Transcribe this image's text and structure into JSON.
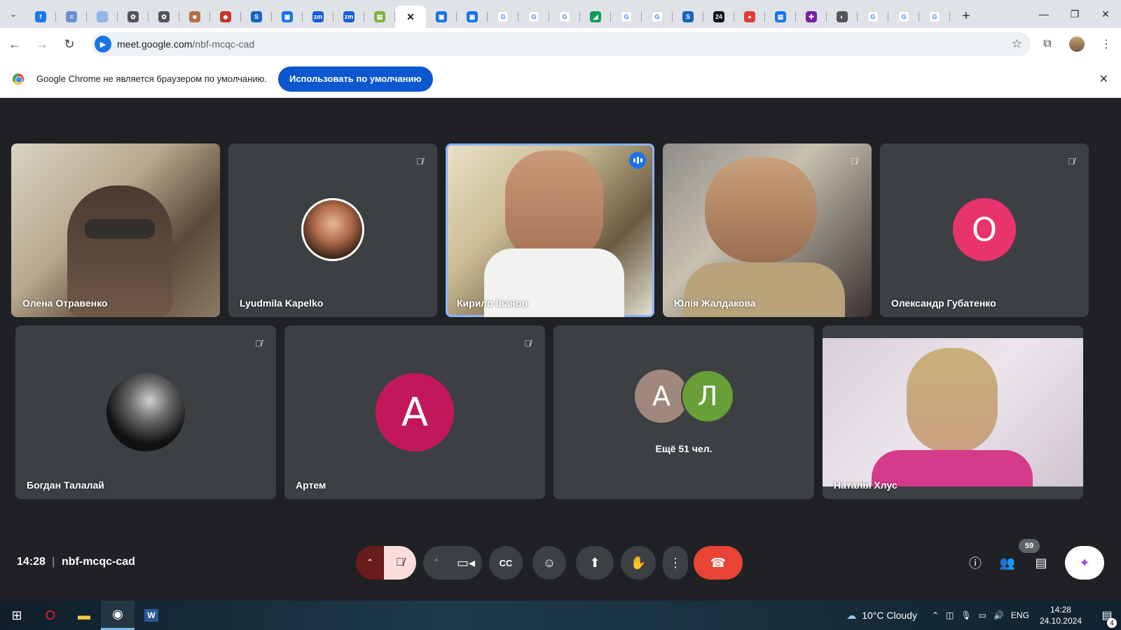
{
  "tabs": [
    {
      "icon": "facebook-icon",
      "glyph": "f",
      "color": "#1877f2"
    },
    {
      "icon": "site-icon",
      "glyph": "≡",
      "color": "#6b8ecf"
    },
    {
      "icon": "site-icon",
      "glyph": "◌",
      "color": "#8fb4e8"
    },
    {
      "icon": "chatgpt-icon",
      "glyph": "✿",
      "color": "#555"
    },
    {
      "icon": "chatgpt-icon",
      "glyph": "✿",
      "color": "#555"
    },
    {
      "icon": "avatar-icon",
      "glyph": "☻",
      "color": "#b0704a"
    },
    {
      "icon": "shield-icon",
      "glyph": "◆",
      "color": "#c0392b"
    },
    {
      "icon": "s-icon",
      "glyph": "S",
      "color": "#1565c0"
    },
    {
      "icon": "doc-icon",
      "glyph": "▣",
      "color": "#1a73e8"
    },
    {
      "icon": "zoom-icon",
      "glyph": "zm",
      "color": "#1a5cd8"
    },
    {
      "icon": "zoom-icon",
      "glyph": "zm",
      "color": "#1a5cd8"
    },
    {
      "icon": "folder-icon",
      "glyph": "▤",
      "color": "#7cb342"
    },
    {
      "icon": "close-icon",
      "glyph": "✕",
      "color": "transparent",
      "active": true
    },
    {
      "icon": "doc-icon",
      "glyph": "▣",
      "color": "#1a73e8"
    },
    {
      "icon": "doc-icon",
      "glyph": "▣",
      "color": "#1a73e8"
    },
    {
      "icon": "google-icon",
      "glyph": "G",
      "color": "#4285f4"
    },
    {
      "icon": "google-icon",
      "glyph": "G",
      "color": "#4285f4"
    },
    {
      "icon": "google-icon",
      "glyph": "G",
      "color": "#4285f4"
    },
    {
      "icon": "chart-icon",
      "glyph": "◢",
      "color": "#0f9d58"
    },
    {
      "icon": "translate-icon",
      "glyph": "G",
      "color": "#4285f4"
    },
    {
      "icon": "google-icon",
      "glyph": "G",
      "color": "#4285f4"
    },
    {
      "icon": "s-icon",
      "glyph": "S",
      "color": "#1565c0"
    },
    {
      "icon": "news-icon",
      "glyph": "24",
      "color": "#111"
    },
    {
      "icon": "red-icon",
      "glyph": "●",
      "color": "#e53935"
    },
    {
      "icon": "doc-icon",
      "glyph": "▤",
      "color": "#1a73e8"
    },
    {
      "icon": "slack-icon",
      "glyph": "✚",
      "color": "#7b1fa2"
    },
    {
      "icon": "globe-icon",
      "glyph": "◐",
      "color": "#555"
    },
    {
      "icon": "google-icon",
      "glyph": "G",
      "color": "#4285f4"
    },
    {
      "icon": "google-icon",
      "glyph": "G",
      "color": "#4285f4"
    },
    {
      "icon": "google-icon",
      "glyph": "G",
      "color": "#4285f4"
    }
  ],
  "address": {
    "host": "meet.google.com",
    "path": "/nbf-mcqc-cad"
  },
  "infobar": {
    "text": "Google Chrome не является браузером по умолчанию.",
    "button": "Использовать по умолчанию"
  },
  "participants": [
    {
      "name": "Олена Отравенко"
    },
    {
      "name": "Lyudmila Kapelko"
    },
    {
      "name": "Кирило Іванов"
    },
    {
      "name": "Юлія Жалдакова"
    },
    {
      "name": "Олександр Губатенко",
      "initial": "О",
      "avatar_color": "#e8336d"
    },
    {
      "name": "Богдан Талалай"
    },
    {
      "name": "Артем",
      "initial": "А",
      "avatar_color": "#c2185b"
    },
    {
      "name": "Наталія Хлус"
    }
  ],
  "more": {
    "initials": [
      "А",
      "Л"
    ],
    "colors": [
      "#a1887f",
      "#689f38"
    ],
    "label": "Ещё 51 чел."
  },
  "meeting": {
    "time": "14:28",
    "code": "nbf-mcqc-cad",
    "participants_count": "59"
  },
  "taskbar": {
    "weather": "10°C  Cloudy",
    "lang": "ENG",
    "time": "14:28",
    "date": "24.10.2024",
    "notifications": "4"
  }
}
